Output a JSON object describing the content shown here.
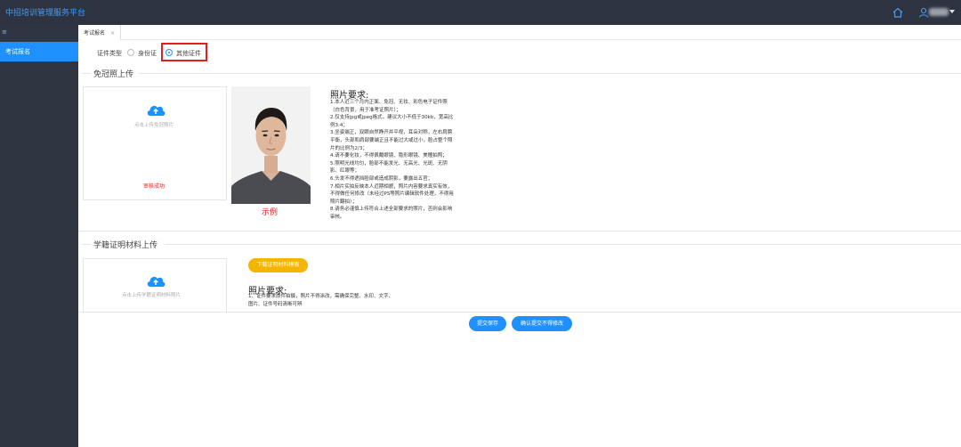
{
  "header": {
    "brand": "中招培训管理服务平台",
    "home_icon": "home-icon",
    "user_icon": "user-icon"
  },
  "sidebar": {
    "toggle": "≡",
    "items": [
      {
        "label": "考试报名",
        "active": true
      }
    ]
  },
  "tabs": [
    {
      "label": "考试报名",
      "close": "×"
    }
  ],
  "cert_type": {
    "label": "证件类型",
    "options": [
      {
        "label": "身份证",
        "checked": false
      },
      {
        "label": "其他证件",
        "checked": true
      }
    ]
  },
  "photo_section": {
    "title": "免冠照上传",
    "upload_hint": "点击上传免冠照片",
    "audit_status": "审核成功",
    "sample_caption": "示例",
    "req_title": "照片要求:",
    "requirements": [
      "1.本人近三个月内正面、免冠、无妆、彩色电子证件照（白色背景，用于准考证照片）；",
      "2.仅支持jpg或jpeg格式，建议大小不低于30kb，宽高比例3:4；",
      "3.坐姿端正，双眼自然睁开并平视，耳朵对称，左右肩膀平衡，头部和肩部要端正且不能过大或过小，脸占整个照片的比例为2/3；",
      "4.请不要化妆，不得佩戴眼镜、隐形眼镜、美瞳拍照；",
      "5.照明光线均匀，脸部不能发光、无高光、光斑、无阴影、红眼等；",
      "6.头发不得遮挡脸部或造成阴影，要露出五官；",
      "7.相片实拍反映本人近期相貌，照片内容要求真实有效，不得做任何修改（未经过PS等照片编辑软件处理，不得用照片翻拍）；",
      "8.请务必谨慎上传符合上述全部要求的照片，否则会影响审核。"
    ]
  },
  "degree_section": {
    "title": "学籍证明材料上传",
    "upload_hint": "点击上传学籍证明材料照片",
    "download_label": "下载证明材料模板",
    "req_title": "照片要求:",
    "requirements": [
      "1、证件要求原件拍摄，照片不得涂改，需确保完整、水印、文字、图片、证件号码清晰可辨"
    ]
  },
  "actions": {
    "save_label": "提交保存",
    "confirm_label": "确认提交不得修改"
  },
  "colors": {
    "primary": "#1e90ff",
    "danger": "#e02020",
    "warning": "#f5b400",
    "topbar": "#2d3340",
    "sidebar": "#2f3642"
  }
}
